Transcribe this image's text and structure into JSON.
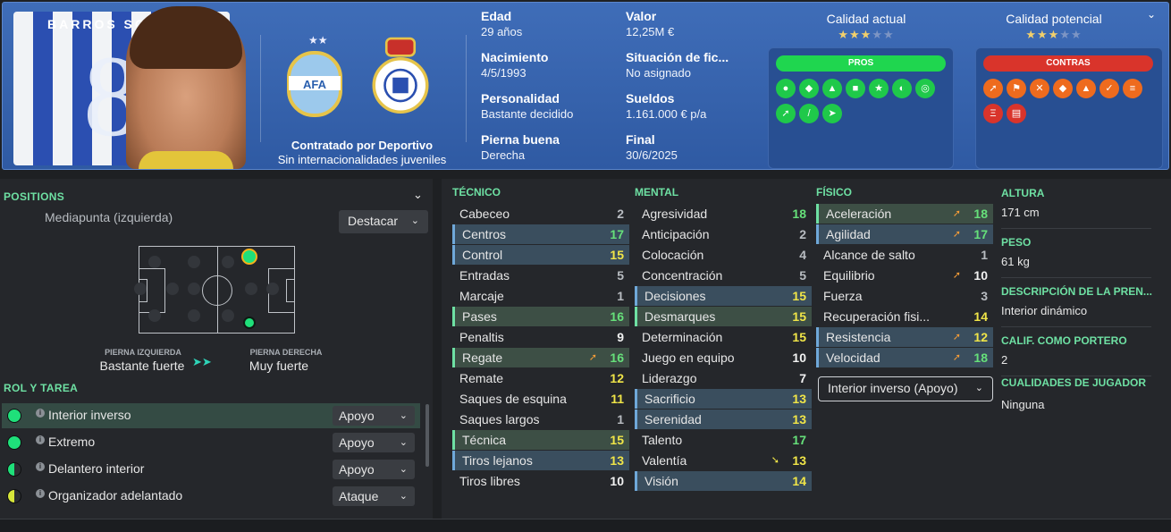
{
  "header": {
    "player_name": "BARROS SCHEL",
    "shirt_number": "8",
    "contract_title": "Contratado por Deportivo",
    "contract_sub": "Sin internacionalidades juveniles",
    "info": [
      {
        "label": "Edad",
        "value": "29 años"
      },
      {
        "label": "Nacimiento",
        "value": "4/5/1993"
      },
      {
        "label": "Personalidad",
        "value": "Bastante decidido"
      },
      {
        "label": "Pierna buena",
        "value": "Derecha"
      },
      {
        "label": "Valor",
        "value": "12,25M €"
      },
      {
        "label": "Situación de fic...",
        "value": "No asignado"
      },
      {
        "label": "Sueldos",
        "value": "1.161.000 € p/a"
      },
      {
        "label": "Final",
        "value": "30/6/2025"
      }
    ],
    "current_ability_label": "Calidad actual",
    "current_ability_stars": 3,
    "potential_ability_label": "Calidad potencial",
    "potential_ability_stars": 3,
    "pros_label": "PROS",
    "cons_label": "CONTRAS",
    "accent_pros": "#1fd64f",
    "accent_cons": "#d9342b"
  },
  "positions": {
    "title": "POSITIONS",
    "position_name": "Mediapunta (izquierda)",
    "highlight_select": "Destacar",
    "left_foot_label": "PIERNA IZQUIERDA",
    "left_foot_value": "Bastante fuerte",
    "right_foot_label": "PIERNA DERECHA",
    "right_foot_value": "Muy fuerte"
  },
  "roles": {
    "title": "ROL Y TAREA",
    "items": [
      {
        "name": "Interior inverso",
        "duty": "Apoyo"
      },
      {
        "name": "Extremo",
        "duty": "Apoyo"
      },
      {
        "name": "Delantero interior",
        "duty": "Apoyo"
      },
      {
        "name": "Organizador adelantado",
        "duty": "Ataque"
      }
    ]
  },
  "tecnico": {
    "title": "TÉCNICO",
    "rows": [
      {
        "name": "Cabeceo",
        "value": "2"
      },
      {
        "name": "Centros",
        "value": "17"
      },
      {
        "name": "Control",
        "value": "15"
      },
      {
        "name": "Entradas",
        "value": "5"
      },
      {
        "name": "Marcaje",
        "value": "1"
      },
      {
        "name": "Pases",
        "value": "16"
      },
      {
        "name": "Penaltis",
        "value": "9"
      },
      {
        "name": "Regate",
        "value": "16"
      },
      {
        "name": "Remate",
        "value": "12"
      },
      {
        "name": "Saques de esquina",
        "value": "11"
      },
      {
        "name": "Saques largos",
        "value": "1"
      },
      {
        "name": "Técnica",
        "value": "15"
      },
      {
        "name": "Tiros lejanos",
        "value": "13"
      },
      {
        "name": "Tiros libres",
        "value": "10"
      }
    ]
  },
  "mental": {
    "title": "MENTAL",
    "rows": [
      {
        "name": "Agresividad",
        "value": "18"
      },
      {
        "name": "Anticipación",
        "value": "2"
      },
      {
        "name": "Colocación",
        "value": "4"
      },
      {
        "name": "Concentración",
        "value": "5"
      },
      {
        "name": "Decisiones",
        "value": "15"
      },
      {
        "name": "Desmarques",
        "value": "15"
      },
      {
        "name": "Determinación",
        "value": "15"
      },
      {
        "name": "Juego en equipo",
        "value": "10"
      },
      {
        "name": "Liderazgo",
        "value": "7"
      },
      {
        "name": "Sacrificio",
        "value": "13"
      },
      {
        "name": "Serenidad",
        "value": "13"
      },
      {
        "name": "Talento",
        "value": "17"
      },
      {
        "name": "Valentía",
        "value": "13"
      },
      {
        "name": "Visión",
        "value": "14"
      }
    ]
  },
  "fisico": {
    "title": "FÍSICO",
    "rows": [
      {
        "name": "Aceleración",
        "value": "18"
      },
      {
        "name": "Agilidad",
        "value": "17"
      },
      {
        "name": "Alcance de salto",
        "value": "1"
      },
      {
        "name": "Equilibrio",
        "value": "10"
      },
      {
        "name": "Fuerza",
        "value": "3"
      },
      {
        "name": "Recuperación fisi...",
        "value": "14"
      },
      {
        "name": "Resistencia",
        "value": "12"
      },
      {
        "name": "Velocidad",
        "value": "18"
      }
    ],
    "role_select": "Interior inverso (Apoyo)"
  },
  "side": {
    "height_label": "ALTURA",
    "height_value": "171 cm",
    "weight_label": "PESO",
    "weight_value": "61 kg",
    "desc_label": "DESCRIPCIÓN DE LA PREN...",
    "desc_value": "Interior dinámico",
    "gk_label": "CALIF. COMO PORTERO",
    "gk_value": "2",
    "qual_label": "CUALIDADES DE JUGADOR",
    "qual_value": "Ninguna"
  }
}
